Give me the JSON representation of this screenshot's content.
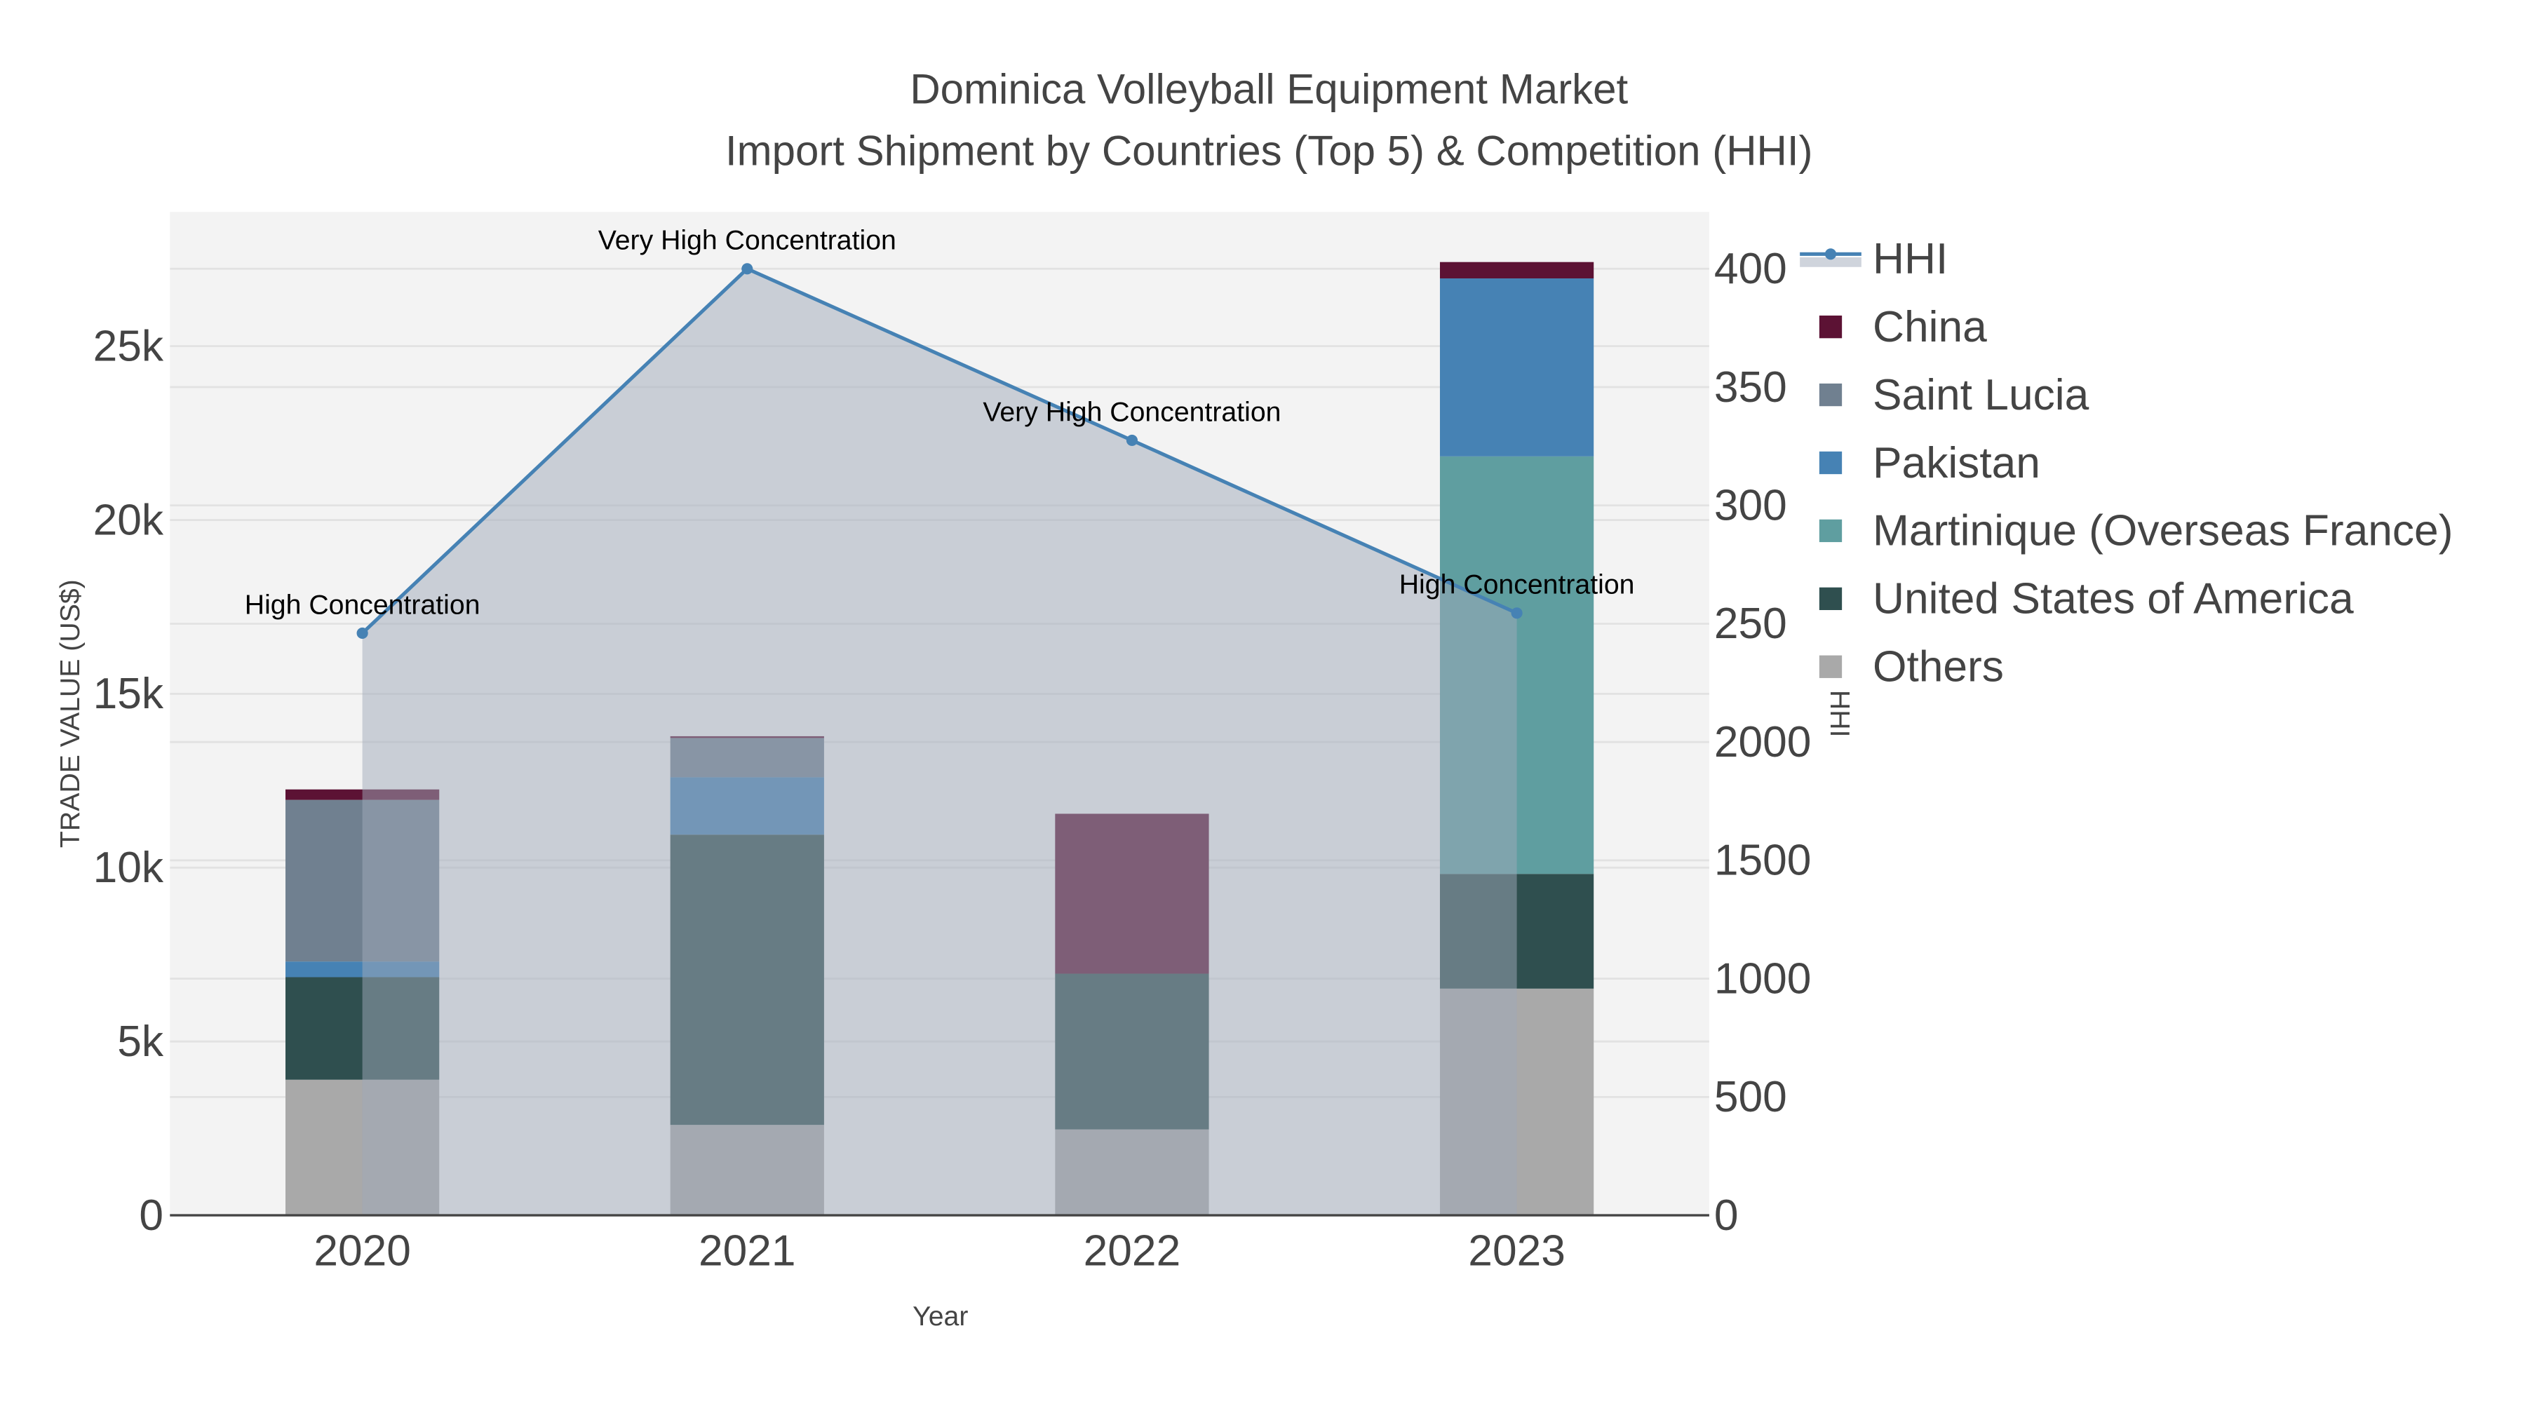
{
  "chart_data": {
    "type": "bar",
    "stacked": true,
    "title": "Dominica Volleyball Equipment Market",
    "subtitle": "Import Shipment by Countries (Top 5) & Competition (HHI)",
    "xlabel": "Year",
    "ylabel": "TRADE VALUE (US$)",
    "y2label": "HHI",
    "categories": [
      "2020",
      "2021",
      "2022",
      "2023"
    ],
    "ylim": [
      0,
      28860
    ],
    "y2lim": [
      0,
      4240
    ],
    "y_ticks": [
      {
        "v": 0,
        "label": "0"
      },
      {
        "v": 5000,
        "label": "5k"
      },
      {
        "v": 10000,
        "label": "10k"
      },
      {
        "v": 15000,
        "label": "15k"
      },
      {
        "v": 20000,
        "label": "20k"
      },
      {
        "v": 25000,
        "label": "25k"
      }
    ],
    "y2_ticks": [
      {
        "v": 0,
        "label": "0"
      },
      {
        "v": 500,
        "label": "500"
      },
      {
        "v": 1000,
        "label": "1000"
      },
      {
        "v": 1500,
        "label": "1500"
      },
      {
        "v": 2000,
        "label": "2000"
      },
      {
        "v": 2500,
        "label": "250"
      },
      {
        "v": 3000,
        "label": "300"
      },
      {
        "v": 3500,
        "label": "350"
      },
      {
        "v": 4000,
        "label": "400"
      }
    ],
    "grid": true,
    "legend_position": "right",
    "series": [
      {
        "name": "Others",
        "color": "#a9a9a9",
        "values": [
          3900,
          2600,
          2470,
          6520
        ]
      },
      {
        "name": "United States of America",
        "color": "#2f4f4f",
        "values": [
          2950,
          8350,
          4480,
          3300
        ]
      },
      {
        "name": "Martinique (Overseas France)",
        "color": "#5f9ea0",
        "values": [
          0,
          0,
          0,
          12010
        ]
      },
      {
        "name": "Pakistan",
        "color": "#4682b4",
        "values": [
          450,
          1650,
          0,
          5120
        ]
      },
      {
        "name": "Saint Lucia",
        "color": "#708090",
        "values": [
          4650,
          1130,
          0,
          0
        ]
      },
      {
        "name": "China",
        "color": "#5c1234",
        "values": [
          300,
          50,
          4600,
          470
        ]
      }
    ],
    "line": {
      "name": "HHI",
      "color": "#4682b4",
      "values": [
        2460,
        4000,
        3275,
        2545
      ],
      "annotations": [
        "High Concentration",
        "Very High Concentration",
        "Very High Concentration",
        "High Concentration"
      ]
    },
    "legend_order": [
      "HHI",
      "China",
      "Saint Lucia",
      "Pakistan",
      "Martinique (Overseas France)",
      "United States of America",
      "Others"
    ]
  }
}
